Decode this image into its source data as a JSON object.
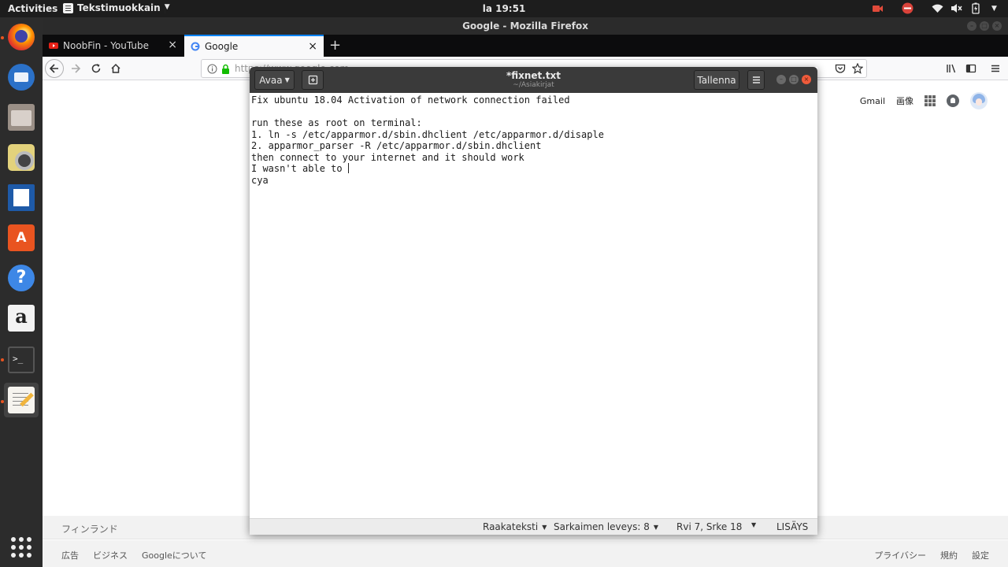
{
  "topbar": {
    "activities": "Activities",
    "app_menu": "Tekstimuokkain",
    "clock": "la 19:51"
  },
  "firefox": {
    "window_title": "Google - Mozilla Firefox",
    "tabs": [
      {
        "label": "NoobFin - YouTube"
      },
      {
        "label": "Google"
      }
    ],
    "url": "https://www.google.com"
  },
  "google": {
    "gmail": "Gmail",
    "images": "画像",
    "country": "フィンランド",
    "footer_left": [
      "広告",
      "ビジネス",
      "Googleについて"
    ],
    "footer_right": [
      "プライバシー",
      "規約",
      "設定"
    ]
  },
  "gedit": {
    "open_label": "Avaa",
    "title": "*fixnet.txt",
    "subtitle": "~/Asiakirjat",
    "save_label": "Tallenna",
    "lines": [
      "Fix ubuntu 18.04 Activation of network connection failed",
      "",
      "run these as root on terminal:",
      "1. ln -s /etc/apparmor.d/sbin.dhclient /etc/apparmor.d/disaple",
      "2. apparmor_parser -R /etc/apparmor.d/sbin.dhclient",
      "then connect to your internet and it should work",
      "I wasn't able to ",
      "cya"
    ],
    "status": {
      "language": "Raakateksti",
      "tab_width": "Sarkaimen leveys: 8",
      "position": "Rvi 7, Srke 18",
      "mode": "LISÄYS"
    }
  },
  "dock_apps": [
    "firefox-icon",
    "thunderbird-icon",
    "files-icon",
    "rhythmbox-icon",
    "writer-icon",
    "software-icon",
    "help-icon",
    "amazon-icon",
    "terminal-icon",
    "text-editor-icon"
  ],
  "colors": {
    "accent": "#e95420",
    "tab_highlight": "#0a84ff",
    "close_button": "#ef5b3b"
  }
}
